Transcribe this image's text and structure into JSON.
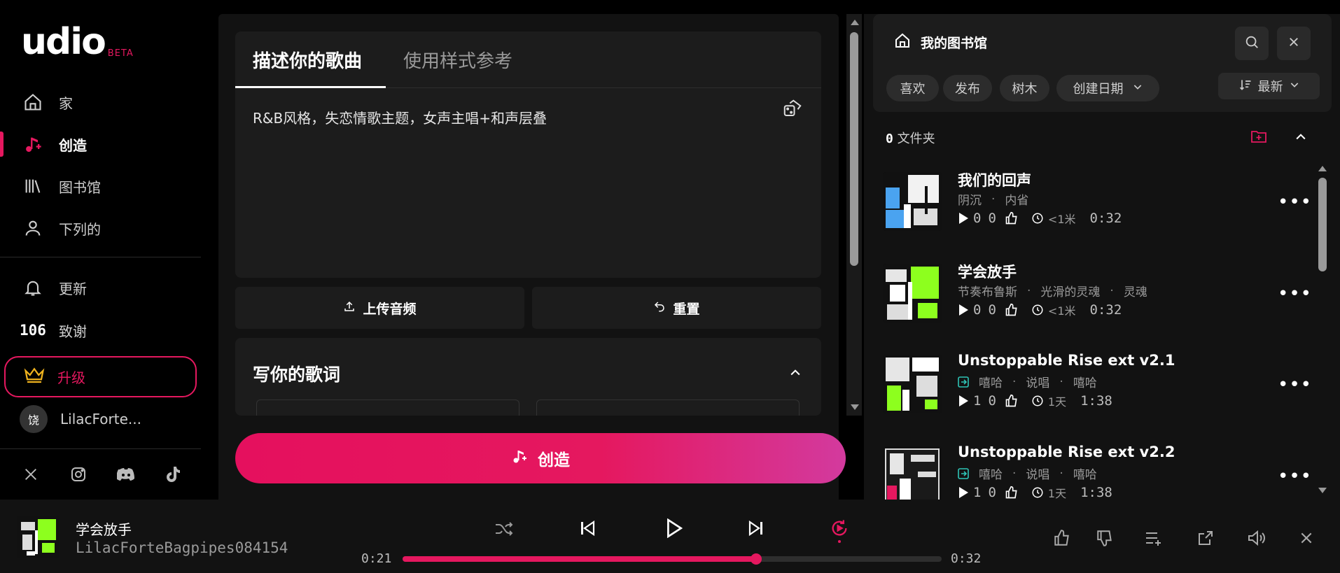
{
  "sidebar": {
    "logo": "udio",
    "beta": "BETA",
    "items": [
      {
        "label": "家",
        "icon": "home-icon"
      },
      {
        "label": "创造",
        "icon": "music-note-icon"
      },
      {
        "label": "图书馆",
        "icon": "library-icon"
      },
      {
        "label": "下列的",
        "icon": "person-icon"
      }
    ],
    "updates_label": "更新",
    "credits_count": "106",
    "credits_label": "致谢",
    "upgrade_label": "升级",
    "user_initial": "饶",
    "user_name": "LilacForte..."
  },
  "editor": {
    "tabs": [
      {
        "label": "描述你的歌曲"
      },
      {
        "label": "使用样式参考"
      }
    ],
    "prompt": "R&B风格，失恋情歌主题，女声主唱+和声层叠",
    "upload_label": "上传音频",
    "reset_label": "重置",
    "lyrics_title": "写你的歌词",
    "create_label": "创造"
  },
  "library": {
    "title": "我的图书馆",
    "chips": [
      "喜欢",
      "发布",
      "树木",
      "创建日期"
    ],
    "sort_label": "最新",
    "folders_count": "0",
    "folders_label": "文件夹",
    "songs": [
      {
        "title": "我们的回声",
        "tags": [
          "阴沉",
          "内省"
        ],
        "plays": "0",
        "likes": "0",
        "age": "<1米",
        "duration": "0:32",
        "published": false
      },
      {
        "title": "学会放手",
        "tags": [
          "节奏布鲁斯",
          "光滑的灵魂",
          "灵魂"
        ],
        "plays": "0",
        "likes": "0",
        "age": "<1米",
        "duration": "0:32",
        "published": false
      },
      {
        "title": "Unstoppable Rise ext v2.1",
        "tags": [
          "嘻哈",
          "说唱",
          "嘻哈"
        ],
        "plays": "1",
        "likes": "0",
        "age": "1天",
        "duration": "1:38",
        "published": true
      },
      {
        "title": "Unstoppable Rise ext v2.2",
        "tags": [
          "嘻哈",
          "说唱",
          "嘻哈"
        ],
        "plays": "1",
        "likes": "0",
        "age": "1天",
        "duration": "1:38",
        "published": true
      }
    ],
    "more_label": "•••"
  },
  "player": {
    "title": "学会放手",
    "artist": "LilacForteBagpipes084154",
    "elapsed": "0:21",
    "total": "0:32",
    "progress": 0.656
  },
  "colors": {
    "accent": "#e5185f",
    "green": "#8dff1e",
    "blue": "#4aa3f0"
  }
}
